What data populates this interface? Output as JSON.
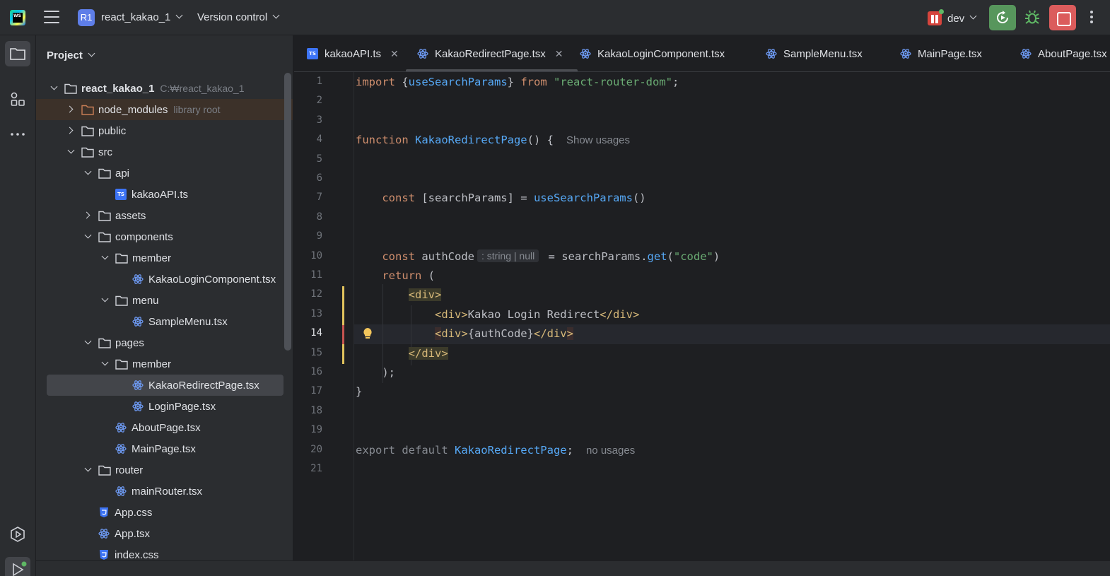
{
  "titlebar": {
    "logo_text": "WS",
    "project_badge": "R1",
    "project_name": "react_kakao_1",
    "vcs_label": "Version control",
    "branch": "dev"
  },
  "panel": {
    "title": "Project"
  },
  "tree": [
    {
      "label": "react_kakao_1",
      "hint": "C:₩react_kakao_1",
      "type": "folder",
      "arrow": "down",
      "depth": 0,
      "bold": true
    },
    {
      "label": "node_modules",
      "hint": "library root",
      "type": "folder-lib",
      "arrow": "right",
      "depth": 1
    },
    {
      "label": "public",
      "type": "folder",
      "arrow": "right",
      "depth": 1
    },
    {
      "label": "src",
      "type": "folder",
      "arrow": "down",
      "depth": 1
    },
    {
      "label": "api",
      "type": "folder",
      "arrow": "down",
      "depth": 2
    },
    {
      "label": "kakaoAPI.ts",
      "type": "ts",
      "arrow": "none",
      "depth": 3
    },
    {
      "label": "assets",
      "type": "folder",
      "arrow": "right",
      "depth": 2
    },
    {
      "label": "components",
      "type": "folder",
      "arrow": "down",
      "depth": 2
    },
    {
      "label": "member",
      "type": "folder",
      "arrow": "down",
      "depth": 3
    },
    {
      "label": "KakaoLoginComponent.tsx",
      "type": "react",
      "arrow": "none",
      "depth": 4
    },
    {
      "label": "menu",
      "type": "folder",
      "arrow": "down",
      "depth": 3
    },
    {
      "label": "SampleMenu.tsx",
      "type": "react",
      "arrow": "none",
      "depth": 4
    },
    {
      "label": "pages",
      "type": "folder",
      "arrow": "down",
      "depth": 2
    },
    {
      "label": "member",
      "type": "folder",
      "arrow": "down",
      "depth": 3
    },
    {
      "label": "KakaoRedirectPage.tsx",
      "type": "react",
      "arrow": "none",
      "depth": 4,
      "selected": true
    },
    {
      "label": "LoginPage.tsx",
      "type": "react",
      "arrow": "none",
      "depth": 4
    },
    {
      "label": "AboutPage.tsx",
      "type": "react",
      "arrow": "none",
      "depth": 3
    },
    {
      "label": "MainPage.tsx",
      "type": "react",
      "arrow": "none",
      "depth": 3
    },
    {
      "label": "router",
      "type": "folder",
      "arrow": "down",
      "depth": 2
    },
    {
      "label": "mainRouter.tsx",
      "type": "react",
      "arrow": "none",
      "depth": 3
    },
    {
      "label": "App.css",
      "type": "css",
      "arrow": "none",
      "depth": 2
    },
    {
      "label": "App.tsx",
      "type": "react",
      "arrow": "none",
      "depth": 2
    },
    {
      "label": "index.css",
      "type": "css",
      "arrow": "none",
      "depth": 2
    }
  ],
  "tabs": [
    {
      "label": "kakaoAPI.ts",
      "icon": "ts",
      "closable": true
    },
    {
      "label": "KakaoRedirectPage.tsx",
      "icon": "react",
      "closable": true,
      "active": true
    },
    {
      "label": "KakaoLoginComponent.tsx",
      "icon": "react"
    },
    {
      "label": "SampleMenu.tsx",
      "icon": "react"
    },
    {
      "label": "MainPage.tsx",
      "icon": "react"
    },
    {
      "label": "AboutPage.tsx",
      "icon": "react"
    }
  ],
  "editor": {
    "current_line": 14,
    "line_numbers": [
      "1",
      "2",
      "3",
      "4",
      "5",
      "6",
      "7",
      "8",
      "9",
      "10",
      "11",
      "12",
      "13",
      "14",
      "15",
      "16",
      "17",
      "18",
      "19",
      "20",
      "21"
    ],
    "lines": [
      [
        {
          "t": "import ",
          "c": "kw"
        },
        {
          "t": "{"
        },
        {
          "t": "useSearchParams",
          "c": "fn"
        },
        {
          "t": "} "
        },
        {
          "t": "from ",
          "c": "kw"
        },
        {
          "t": "\"react-router-dom\"",
          "c": "str"
        },
        {
          "t": ";"
        }
      ],
      [],
      [],
      [
        {
          "t": "function ",
          "c": "kw"
        },
        {
          "t": "KakaoRedirectPage",
          "c": "fn"
        },
        {
          "t": "() {"
        },
        {
          "t": "Show usages",
          "c": "inlay"
        }
      ],
      [],
      [],
      [
        {
          "t": "    const ",
          "c": "kw"
        },
        {
          "t": "[searchParams] = "
        },
        {
          "t": "useSearchParams",
          "c": "fn"
        },
        {
          "t": "()"
        }
      ],
      [],
      [],
      [
        {
          "t": "    const ",
          "c": "kw"
        },
        {
          "t": "authCode"
        },
        {
          "t": ": string | null",
          "c": "inlay-box"
        },
        {
          "t": " = searchParams."
        },
        {
          "t": "get",
          "c": "fn"
        },
        {
          "t": "("
        },
        {
          "t": "\"code\"",
          "c": "str"
        },
        {
          "t": ")"
        }
      ],
      [
        {
          "t": "    return ",
          "c": "kw"
        },
        {
          "t": "("
        }
      ],
      [
        {
          "t": "        "
        },
        {
          "t": "<div>",
          "c": "tag tagbg"
        }
      ],
      [
        {
          "t": "            "
        },
        {
          "t": "<div>",
          "c": "tag"
        },
        {
          "t": "Kakao Login Redirect"
        },
        {
          "t": "</div>",
          "c": "tag"
        }
      ],
      [
        {
          "t": "            "
        },
        {
          "t": "<",
          "c": "tag tagbg-red"
        },
        {
          "t": "div>",
          "c": "tag"
        },
        {
          "t": "{authCode}"
        },
        {
          "t": "</div",
          "c": "tag"
        },
        {
          "t": ">",
          "c": "tag tagbg-red"
        }
      ],
      [
        {
          "t": "        "
        },
        {
          "t": "</div>",
          "c": "tag tagbg"
        }
      ],
      [
        {
          "t": "    );"
        }
      ],
      [
        {
          "t": "}"
        }
      ],
      [],
      [],
      [
        {
          "t": "export default ",
          "c": "muted"
        },
        {
          "t": "KakaoRedirectPage",
          "c": "fn"
        },
        {
          "t": ";"
        },
        {
          "t": "no usages",
          "c": "inlay"
        }
      ],
      []
    ]
  },
  "colors": {
    "accent": "#5e7ee8",
    "run_green": "#57965c",
    "stop_red": "#db5c5c",
    "keyword": "#cf8e6d",
    "function": "#56a8f5",
    "string": "#6aab73",
    "tag": "#d5b778"
  }
}
